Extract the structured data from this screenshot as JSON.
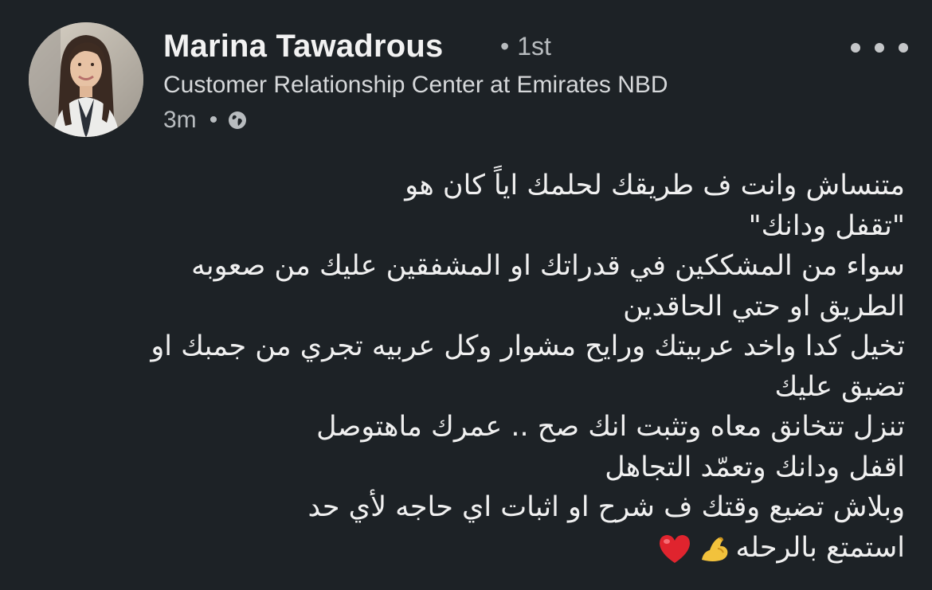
{
  "post": {
    "author": {
      "name": "Marina Tawadrous",
      "degree": "1st",
      "headline": "Customer Relationship Center at Emirates NBD",
      "time": "3m",
      "visibility_icon": "globe-icon",
      "avatar": "profile-photo"
    },
    "menu_icon": "more-horizontal-icon",
    "body_lines": [
      "متنساش وانت ف طريقك لحلمك اياً كان هو",
      "\"تقفل ودانك\"",
      "سواء من المشككين في قدراتك او المشفقين عليك من صعوبه",
      "الطريق او حتي الحاقدين",
      "تخيل كدا واخد عربيتك ورايح مشوار وكل عربيه تجري من جمبك او",
      "تضيق عليك",
      "تنزل تتخانق معاه وتثبت انك صح .. عمرك ماهتوصل",
      "اقفل ودانك وتعمّد التجاهل",
      "وبلاش تضيع وقتك ف شرح او اثبات اي حاجه لأي حد",
      "استمتع بالرحله"
    ],
    "emojis": [
      "flexed-biceps-icon",
      "red-heart-icon"
    ]
  },
  "colors": {
    "background": "#1d2226",
    "text_primary": "#f0f0f0",
    "text_secondary": "#b8bcbf"
  }
}
